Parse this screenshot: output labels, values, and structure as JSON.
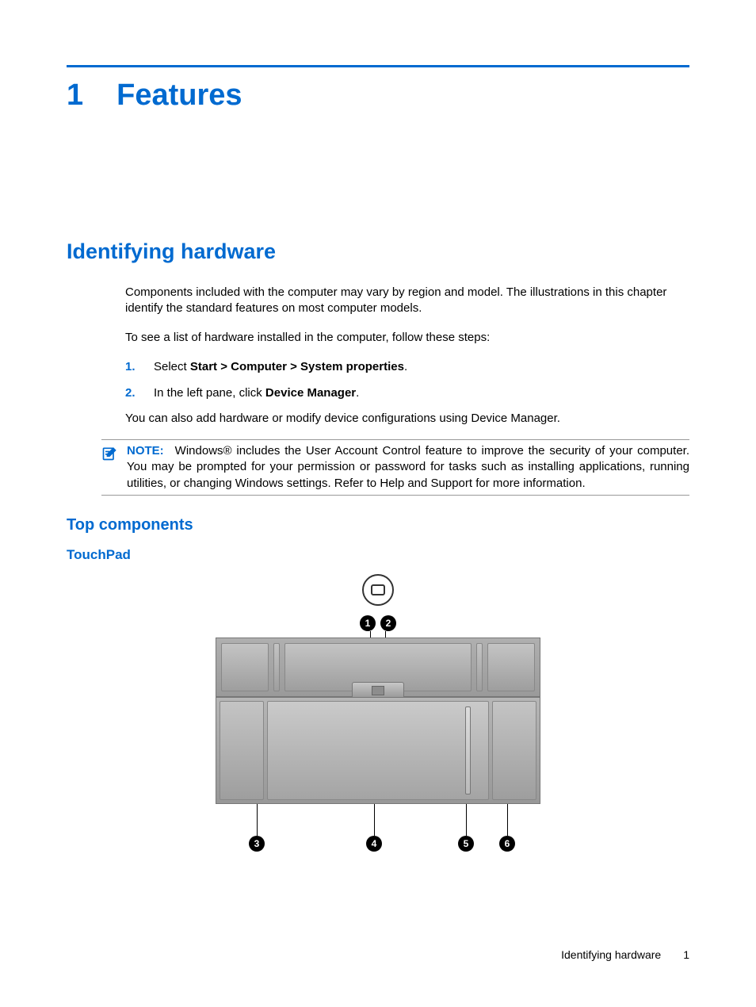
{
  "chapter": {
    "number": "1",
    "title": "Features"
  },
  "section": {
    "title": "Identifying hardware"
  },
  "intro": {
    "p1": "Components included with the computer may vary by region and model. The illustrations in this chapter identify the standard features on most computer models.",
    "p2": "To see a list of hardware installed in the computer, follow these steps:"
  },
  "steps": {
    "s1_num": "1.",
    "s1_pre": "Select ",
    "s1_bold": "Start > Computer > System properties",
    "s1_post": ".",
    "s2_num": "2.",
    "s2_pre": "In the left pane, click ",
    "s2_bold": "Device Manager",
    "s2_post": "."
  },
  "after_steps": "You can also add hardware or modify device configurations using Device Manager.",
  "note": {
    "label": "NOTE:",
    "text": "Windows® includes the User Account Control feature to improve the security of your computer. You may be prompted for your permission or password for tasks such as installing applications, running utilities, or changing Windows settings. Refer to Help and Support for more information."
  },
  "subsection": {
    "title": "Top components"
  },
  "subsubsection": {
    "title": "TouchPad"
  },
  "callouts": {
    "c1": "1",
    "c2": "2",
    "c3": "3",
    "c4": "4",
    "c5": "5",
    "c6": "6"
  },
  "footer": {
    "section": "Identifying hardware",
    "page": "1"
  }
}
